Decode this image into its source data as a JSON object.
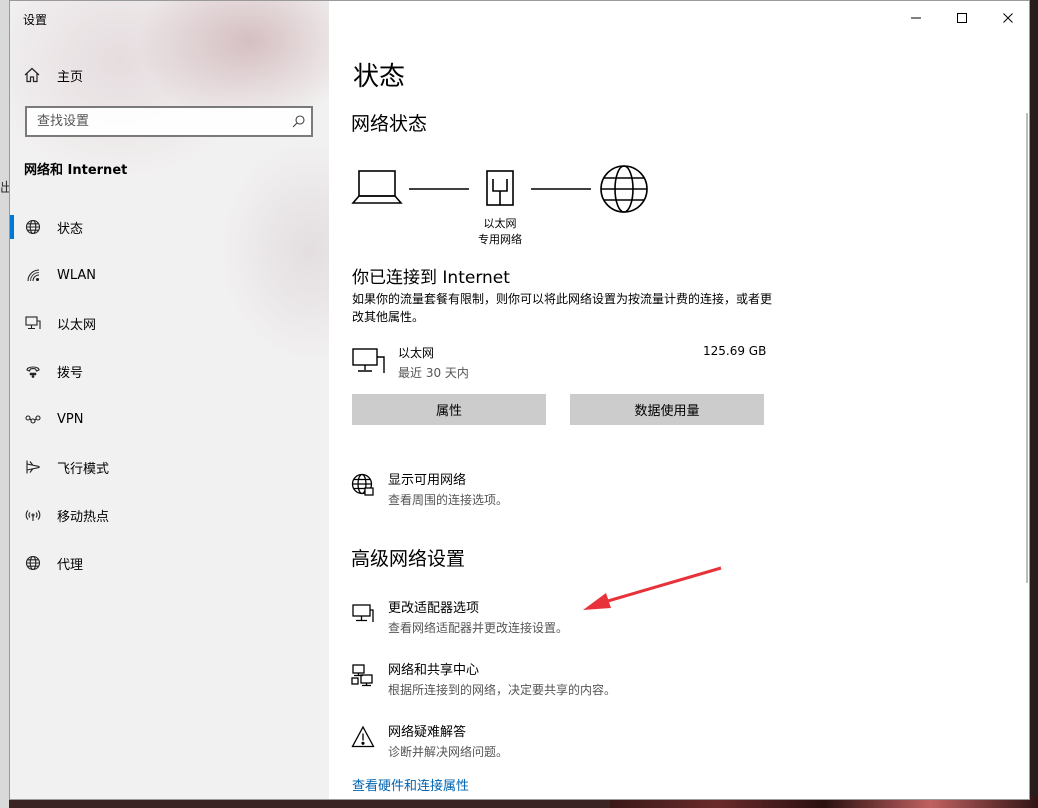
{
  "window": {
    "title": "设置"
  },
  "desktop": {
    "left_fragment": "出"
  },
  "sidebar": {
    "home_label": "主页",
    "search_placeholder": "查找设置",
    "section_title": "网络和 Internet",
    "items": [
      {
        "label": "状态",
        "icon": "globe-status-icon",
        "active": true
      },
      {
        "label": "WLAN",
        "icon": "wifi-icon",
        "active": false
      },
      {
        "label": "以太网",
        "icon": "ethernet-icon",
        "active": false
      },
      {
        "label": "拨号",
        "icon": "dialup-icon",
        "active": false
      },
      {
        "label": "VPN",
        "icon": "vpn-icon",
        "active": false
      },
      {
        "label": "飞行模式",
        "icon": "airplane-icon",
        "active": false
      },
      {
        "label": "移动热点",
        "icon": "hotspot-icon",
        "active": false
      },
      {
        "label": "代理",
        "icon": "globe-icon",
        "active": false
      }
    ]
  },
  "main": {
    "title": "状态",
    "network_status_heading": "网络状态",
    "diagram": {
      "label_line1": "以太网",
      "label_line2": "专用网络"
    },
    "connected_title": "你已连接到 Internet",
    "connected_desc": "如果你的流量套餐有限制，则你可以将此网络设置为按流量计费的连接，或者更改其他属性。",
    "adapter": {
      "name": "以太网",
      "period": "最近 30 天内",
      "usage": "125.69 GB"
    },
    "buttons": {
      "properties": "属性",
      "data_usage": "数据使用量"
    },
    "show_networks": {
      "title": "显示可用网络",
      "desc": "查看周围的连接选项。"
    },
    "advanced_heading": "高级网络设置",
    "advanced_items": [
      {
        "title": "更改适配器选项",
        "desc": "查看网络适配器并更改连接设置。",
        "icon": "adapter-settings-icon"
      },
      {
        "title": "网络和共享中心",
        "desc": "根据所连接到的网络，决定要共享的内容。",
        "icon": "sharing-center-icon"
      },
      {
        "title": "网络疑难解答",
        "desc": "诊断并解决网络问题。",
        "icon": "warning-icon"
      }
    ],
    "hardware_link": "查看硬件和连接属性"
  },
  "colors": {
    "accent": "#0078d7",
    "link": "#0063b1",
    "button": "#cccccc",
    "arrow": "#e8323a"
  }
}
